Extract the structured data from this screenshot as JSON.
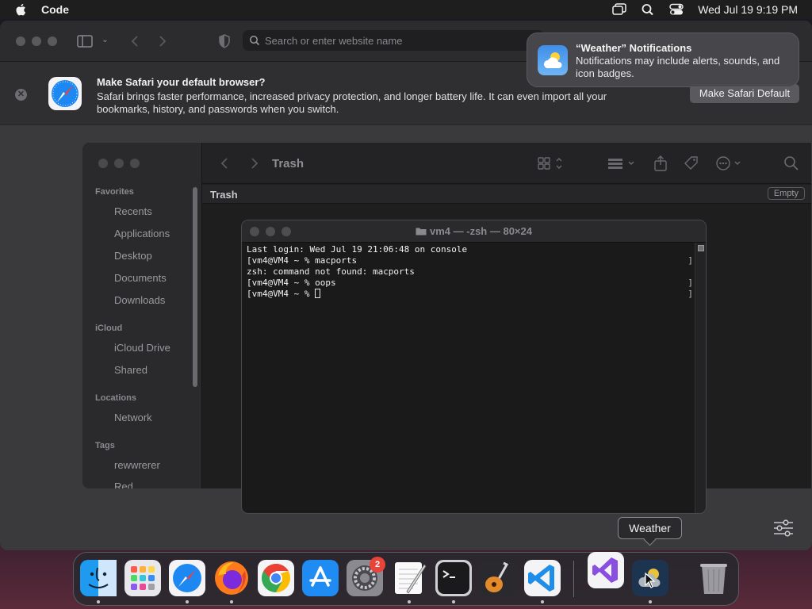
{
  "menubar": {
    "app_name": "Code",
    "clock": "Wed Jul 19  9:19 PM"
  },
  "safari": {
    "address_placeholder": "Search or enter website name",
    "banner": {
      "title": "Make Safari your default browser?",
      "description": "Safari brings faster performance, increased privacy protection, and longer battery life. It can even import all your bookmarks, history, and passwords when you switch.",
      "button": "Make Safari Default"
    }
  },
  "notification": {
    "title": "“Weather” Notifications",
    "body": "Notifications may include alerts, sounds, and icon badges."
  },
  "finder": {
    "title": "Trash",
    "path_label": "Trash",
    "empty_button": "Empty",
    "sections": {
      "favorites": "Favorites",
      "icloud": "iCloud",
      "locations": "Locations",
      "tags": "Tags"
    },
    "items": {
      "recents": "Recents",
      "applications": "Applications",
      "desktop": "Desktop",
      "documents": "Documents",
      "downloads": "Downloads",
      "icloud_drive": "iCloud Drive",
      "shared": "Shared",
      "network": "Network",
      "tag1": "rewwrerer",
      "tag2": "Red"
    }
  },
  "terminal": {
    "title": "vm4 — -zsh — 80×24",
    "lines": [
      "Last login: Wed Jul 19 21:06:48 on console",
      "[vm4@VM4 ~ % macports",
      "zsh: command not found: macports",
      "[vm4@VM4 ~ % oops",
      "[vm4@VM4 ~ % "
    ]
  },
  "dock": {
    "tooltip": "Weather",
    "settings_badge": "2",
    "apps": [
      "Finder",
      "Launchpad",
      "Safari",
      "Firefox",
      "Chrome",
      "App Store",
      "System Settings",
      "TextEdit",
      "Terminal",
      "GarageBand",
      "Visual Studio Code",
      "Visual Studio",
      "Weather",
      "Trash"
    ]
  },
  "colors": {
    "accent": "#0a84ff",
    "badge": "#e8443a"
  }
}
